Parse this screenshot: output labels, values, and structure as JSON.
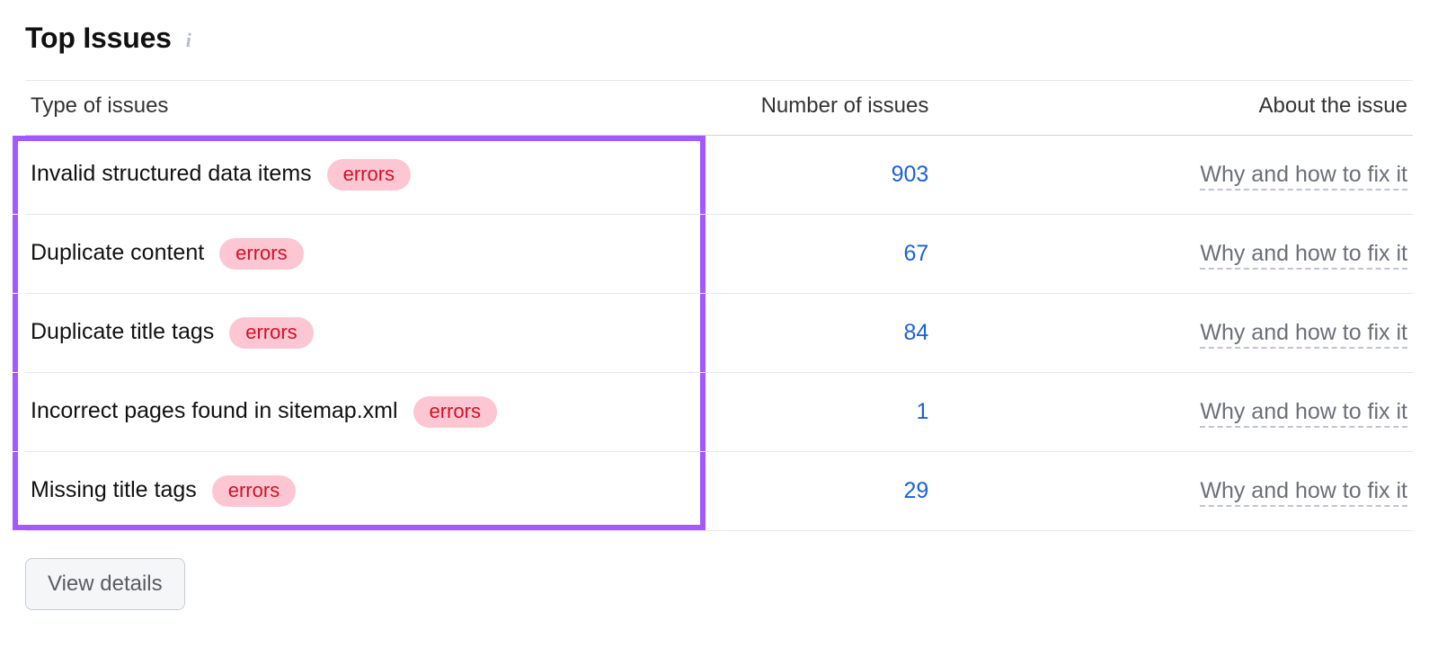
{
  "header": {
    "title": "Top Issues"
  },
  "columns": {
    "type": "Type of issues",
    "count": "Number of issues",
    "about": "About the issue"
  },
  "badge_label": "errors",
  "fix_link_label": "Why and how to fix it",
  "rows": [
    {
      "name": "Invalid structured data items",
      "count": "903"
    },
    {
      "name": "Duplicate content",
      "count": "67"
    },
    {
      "name": "Duplicate title tags",
      "count": "84"
    },
    {
      "name": "Incorrect pages found in sitemap.xml",
      "count": "1"
    },
    {
      "name": "Missing title tags",
      "count": "29"
    }
  ],
  "footer": {
    "view_details": "View details"
  }
}
